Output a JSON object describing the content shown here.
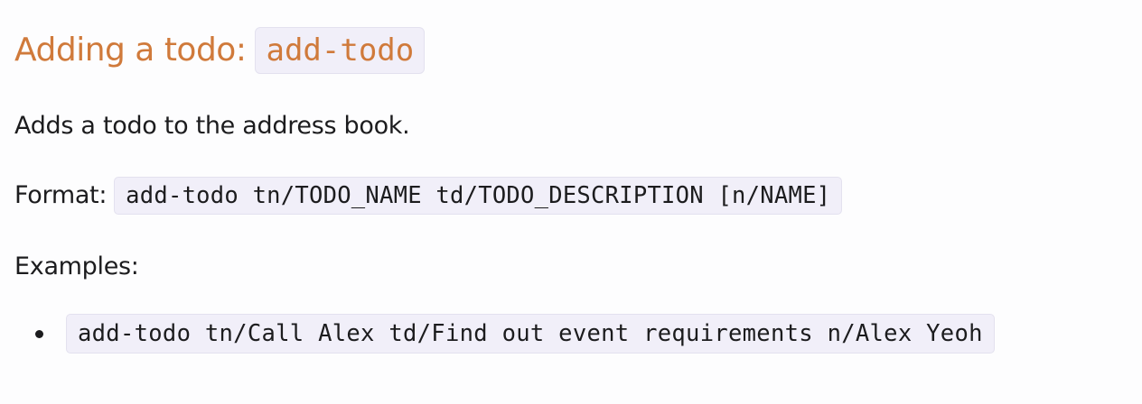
{
  "section": {
    "title": "Adding a todo:",
    "command": "add-todo"
  },
  "description": "Adds a todo to the address book.",
  "format": {
    "label": "Format:",
    "syntax": "add-todo tn/TODO_NAME td/TODO_DESCRIPTION [n/NAME]"
  },
  "examples": {
    "label": "Examples:",
    "items": [
      "add-todo tn/Call Alex td/Find out event requirements n/Alex Yeoh"
    ]
  },
  "colors": {
    "heading": "#d07a3b",
    "code_background": "#f1eff9",
    "text": "#1c1c1e"
  }
}
